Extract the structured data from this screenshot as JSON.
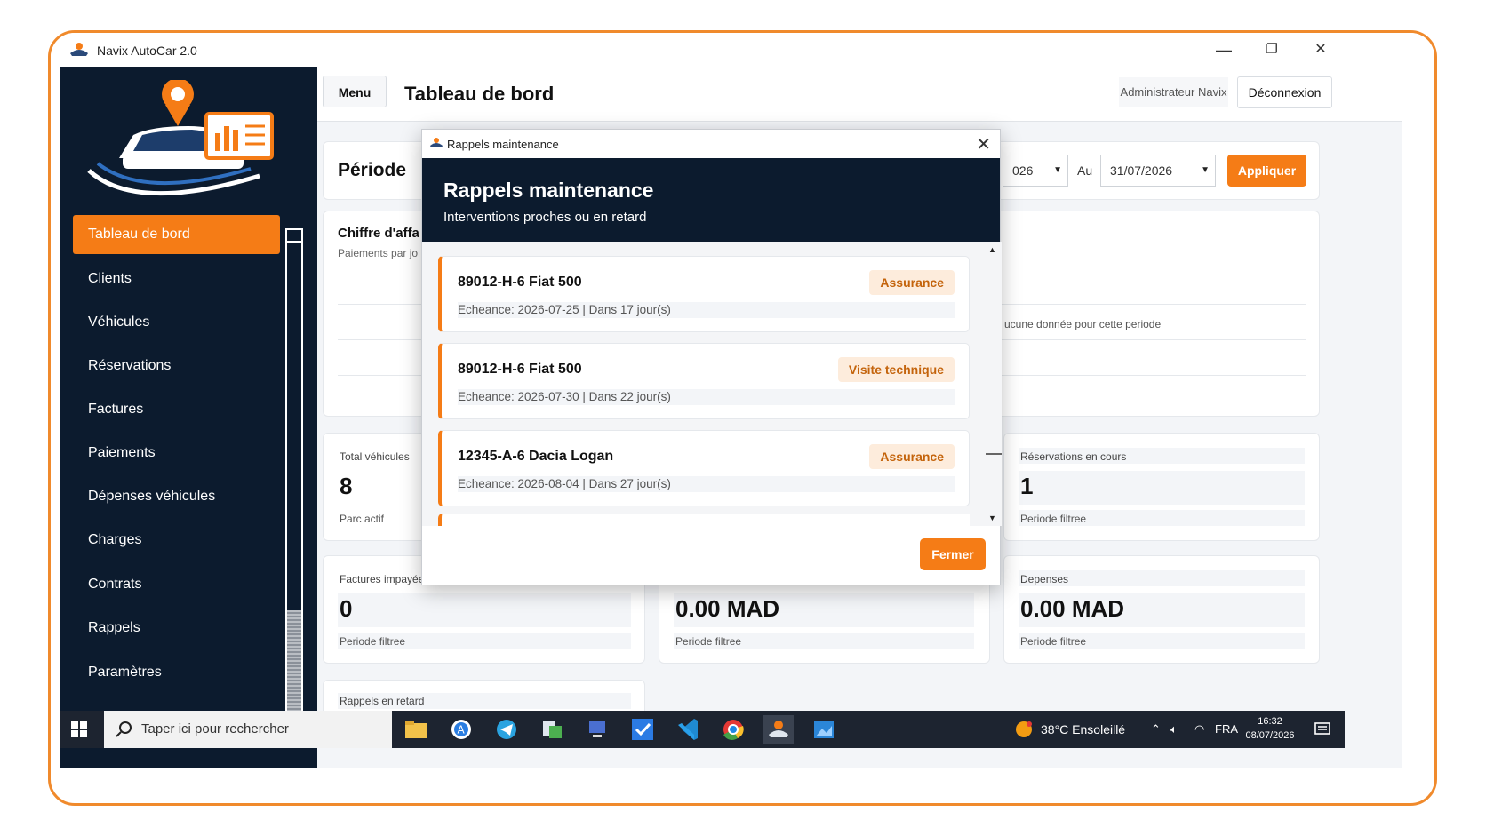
{
  "window": {
    "title": "Navix AutoCar 2.0",
    "minimize": "—",
    "maximize": "❐",
    "close": "✕"
  },
  "sidebar": {
    "items": [
      {
        "label": "Tableau de bord",
        "active": true
      },
      {
        "label": "Clients"
      },
      {
        "label": "Véhicules"
      },
      {
        "label": "Réservations"
      },
      {
        "label": "Factures"
      },
      {
        "label": "Paiements"
      },
      {
        "label": "Dépenses véhicules"
      },
      {
        "label": "Charges"
      },
      {
        "label": "Contrats"
      },
      {
        "label": "Rappels"
      },
      {
        "label": "Paramètres"
      }
    ]
  },
  "topbar": {
    "menu": "Menu",
    "title": "Tableau de bord",
    "user": "Administrateur Navix",
    "logout": "Déconnexion"
  },
  "period": {
    "label": "Période",
    "from_value": "026",
    "to_label": "Au",
    "to_value": "31/07/2026",
    "apply": "Appliquer"
  },
  "revenue": {
    "title": "Chiffre d'affa",
    "subtitle": "Paiements par jo",
    "empty": "ucune donnée pour cette periode"
  },
  "kpis": {
    "vehicles": {
      "label": "Total véhicules",
      "value": "8",
      "sub": "Parc actif"
    },
    "reservations": {
      "label": "Réservations en cours",
      "value": "1",
      "sub": "Periode filtree"
    },
    "unpaid": {
      "label": "Factures impayée",
      "value": "0",
      "sub": "Periode filtree"
    },
    "revenue": {
      "value": "0.00 MAD",
      "sub": "Periode filtree"
    },
    "expenses": {
      "label": "Depenses",
      "value": "0.00 MAD",
      "sub": "Periode filtree"
    },
    "late": {
      "label": "Rappels en retard"
    }
  },
  "modal": {
    "window_title": "Rappels maintenance",
    "heading": "Rappels maintenance",
    "subheading": "Interventions proches ou en retard",
    "reminders": [
      {
        "plate": "89012-H-6 Fiat 500",
        "tag": "Assurance",
        "due": "Echeance: 2026-07-25 | Dans 17 jour(s)"
      },
      {
        "plate": "89012-H-6 Fiat 500",
        "tag": "Visite technique",
        "due": "Echeance: 2026-07-30 | Dans 22 jour(s)"
      },
      {
        "plate": "12345-A-6 Dacia Logan",
        "tag": "Assurance",
        "due": "Echeance: 2026-08-04 | Dans 27 jour(s)"
      }
    ],
    "close": "Fermer"
  },
  "taskbar": {
    "search_placeholder": "Taper ici pour rechercher",
    "weather": "38°C  Ensoleillé",
    "language": "FRA",
    "time": "16:32",
    "date": "08/07/2026"
  },
  "colors": {
    "accent": "#f57c16",
    "navy": "#0c1b2e",
    "frame": "#f08a2c"
  }
}
